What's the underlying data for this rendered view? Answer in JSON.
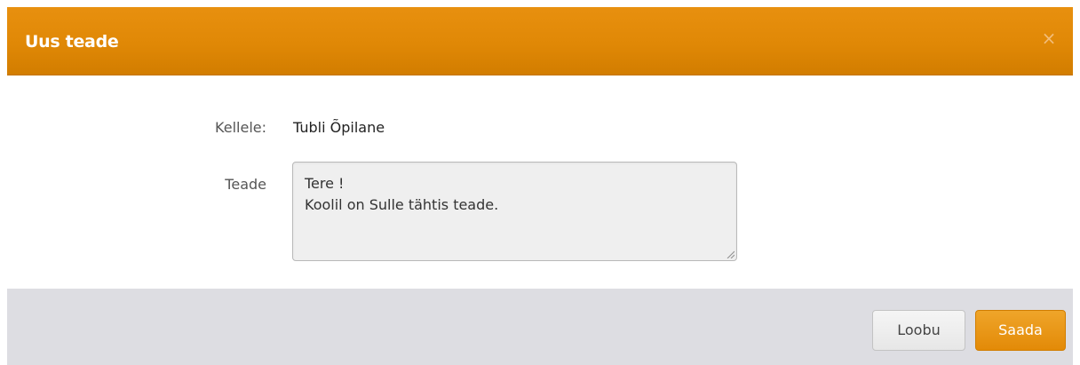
{
  "dialog": {
    "title": "Uus teade",
    "close_icon": "close-icon"
  },
  "form": {
    "recipient_label": "Kellele:",
    "recipient_value": "Tubli Õpilane",
    "message_label": "Teade",
    "message_lines": [
      "Tere !",
      "Koolil on Sulle tähtis teade."
    ]
  },
  "footer": {
    "cancel_label": "Loobu",
    "send_label": "Saada"
  },
  "colors": {
    "header": "#e08806",
    "header_text": "#ffffff",
    "close_icon": "#f2bd7a",
    "field_background": "#efefef",
    "field_border": "#b9b9b9",
    "footer_background": "#dddde2",
    "cancel_button": "#e7e7e7",
    "send_button": "#e38a07"
  }
}
